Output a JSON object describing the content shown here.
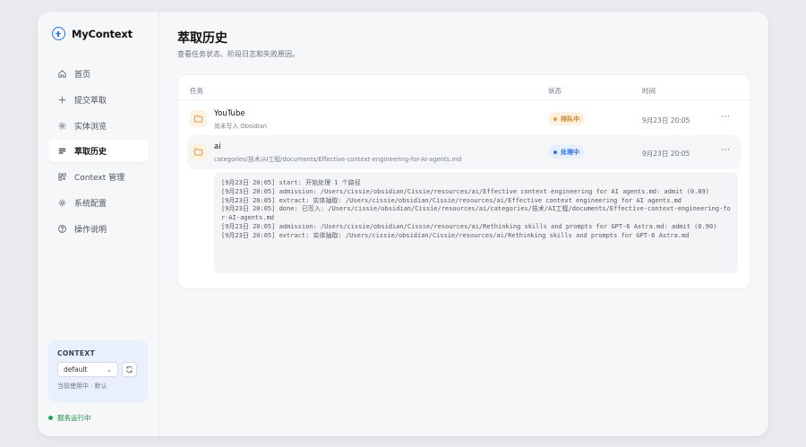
{
  "app": {
    "name": "MyContext"
  },
  "nav": [
    {
      "label": "首页",
      "icon": "home-icon"
    },
    {
      "label": "提交萃取",
      "icon": "plus-icon"
    },
    {
      "label": "实体浏览",
      "icon": "sparkle-icon"
    },
    {
      "label": "萃取历史",
      "icon": "list-icon",
      "active": true
    },
    {
      "label": "Context 管理",
      "icon": "grid-icon"
    },
    {
      "label": "系统配置",
      "icon": "gear-icon"
    },
    {
      "label": "操作说明",
      "icon": "help-icon"
    }
  ],
  "context": {
    "title": "CONTEXT",
    "selected": "default",
    "note": "当前使用中 · 默认"
  },
  "service_status": "服务运行中",
  "page": {
    "title": "萃取历史",
    "subtitle": "查看任务状态、阶段日志和失败原因。"
  },
  "table": {
    "headers": {
      "task": "任务",
      "status": "状态",
      "time": "时间"
    },
    "rows": [
      {
        "name": "YouTube",
        "sub": "尚未写入 Obsidian",
        "status": "排队中",
        "time": "9月23日 20:05"
      },
      {
        "name": "ai",
        "sub": "categories/技术/AI工程/documents/Effective-context-engineering-for-AI-agents.md",
        "status": "处理中",
        "time": "9月23日 20:05"
      }
    ]
  },
  "log": [
    "[9月23日 20:05] start: 开始处理 1 个路径",
    "[9月23日 20:05] admission: /Users/cissie/obsidian/Cissie/resources/ai/Effective context engineering for AI agents.md: admit (0.89)",
    "[9月23日 20:05] extract: 实体抽取: /Users/cissie/obsidian/Cissie/resources/ai/Effective context engineering for AI agents.md",
    "[9月23日 20:05] done: 已写入: /Users/cissie/obsidian/Cissie/resources/ai/categories/技术/AI工程/documents/Effective-context-engineering-for-AI-agents.md",
    "[9月23日 20:05] admission: /Users/cissie/obsidian/Cissie/resources/ai/Rethinking skills and prompts for GPT-6 Astra.md: admit (0.90)",
    "[9月23日 20:05] extract: 实体抽取: /Users/cissie/obsidian/Cissie/resources/ai/Rethinking skills and prompts for GPT-6 Astra.md"
  ],
  "colors": {
    "accent": "#2f6fed",
    "queued": "#d97a0f",
    "processing": "#2f6fed",
    "running": "#22a559"
  }
}
